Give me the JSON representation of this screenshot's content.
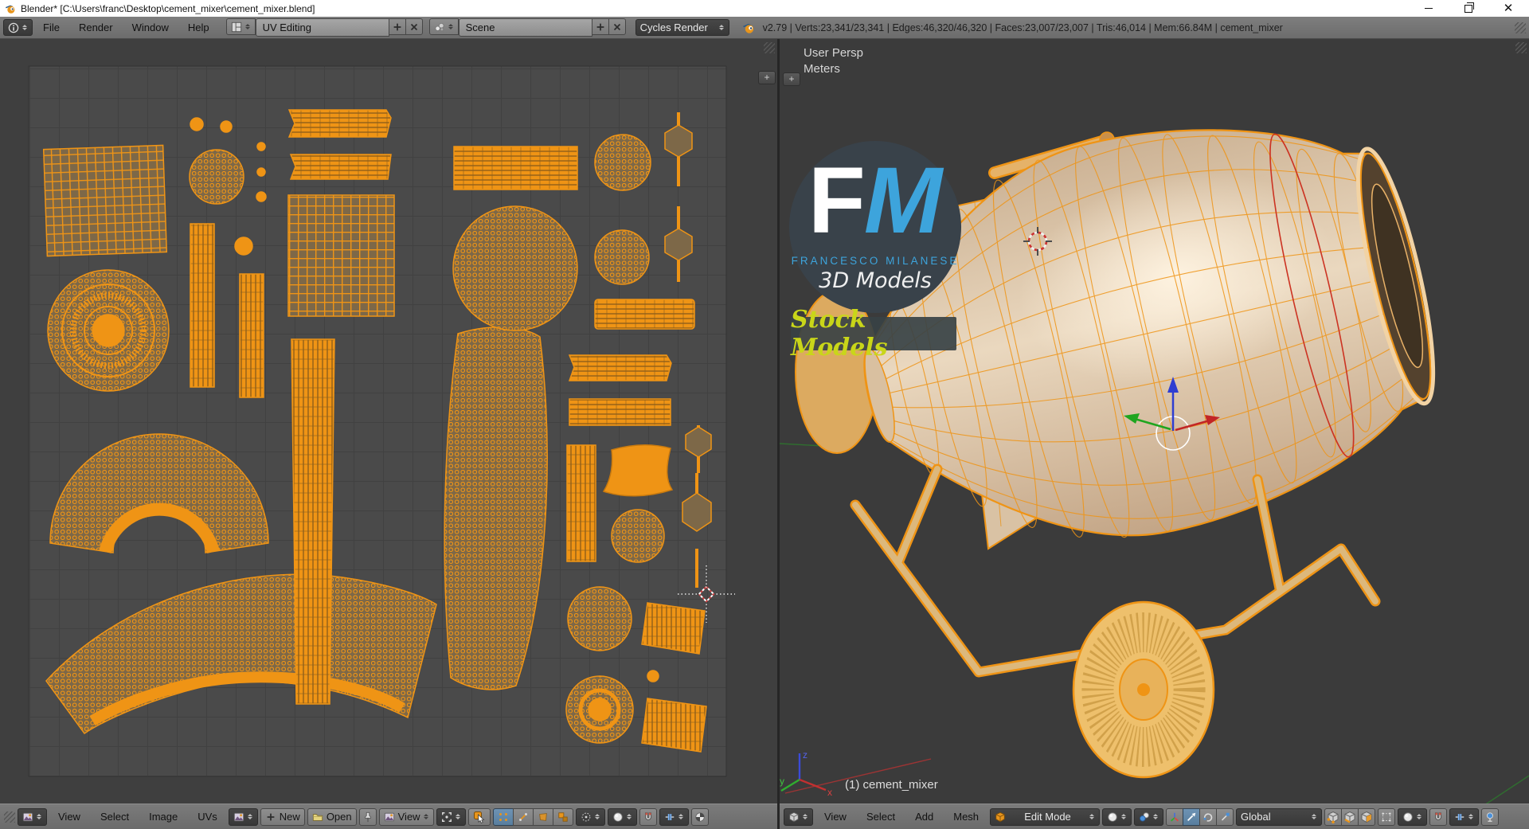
{
  "colors": {
    "accent": "#ef9415",
    "island_fill": "#7d6848",
    "uv_bg": "#4a4a4a",
    "uv_grid": "#414141",
    "viewport_bg": "#3b3b3b",
    "header_bg": "#747474",
    "field_dark": "#3f3f3f",
    "selected_blue": "#5f87aa",
    "logo_blue": "#3da4dc",
    "badge_yellow": "#c9d619",
    "drum_tan": "#dcc7ab",
    "axis_x_red": "#c23030",
    "axis_y_green": "#2fae2f",
    "axis_z_blue": "#3b4bd8"
  },
  "titlebar": {
    "title": "Blender* [C:\\Users\\franc\\Desktop\\cement_mixer\\cement_mixer.blend]"
  },
  "menubar": {
    "menus": [
      "File",
      "Render",
      "Window",
      "Help"
    ],
    "workspace": "UV Editing",
    "scene": "Scene",
    "engine": "Cycles Render",
    "stats": "v2.79 | Verts:23,341/23,341 | Edges:46,320/46,320 | Faces:23,007/23,007 | Tris:46,014 | Mem:66.84M | cement_mixer"
  },
  "uv_header": {
    "menus": [
      "View",
      "Select",
      "Image",
      "UVs"
    ],
    "new_label": "New",
    "open_label": "Open",
    "view_label": "View"
  },
  "v3d_header": {
    "menus": [
      "View",
      "Select",
      "Add",
      "Mesh"
    ],
    "mode": "Edit Mode",
    "orientation": "Global"
  },
  "viewport": {
    "persp": "User Persp",
    "unit": "Meters",
    "object": "(1) cement_mixer",
    "axis": {
      "x": "x",
      "y": "y",
      "z": "z"
    }
  },
  "logo": {
    "f": "F",
    "m": "M",
    "name": "FRANCESCO MILANESE",
    "sub": "3D Models",
    "badge": "Stock Models"
  }
}
